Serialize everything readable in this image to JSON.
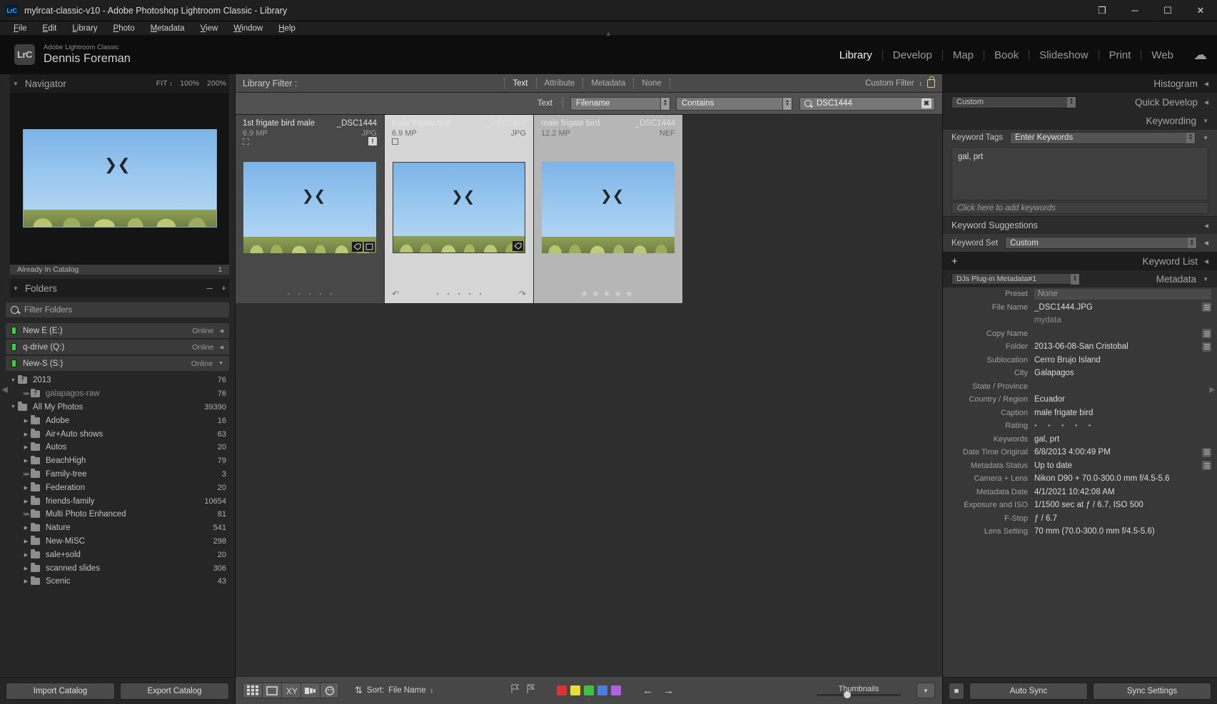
{
  "window": {
    "title": "mylrcat-classic-v10 - Adobe Photoshop Lightroom Classic - Library",
    "logo": "LrC",
    "restore_icon": "❐",
    "minimize_icon": "─",
    "maximize_icon": "☐",
    "close_icon": "✕"
  },
  "menubar": {
    "items": [
      "File",
      "Edit",
      "Library",
      "Photo",
      "Metadata",
      "View",
      "Window",
      "Help"
    ]
  },
  "identity": {
    "badge": "LrC",
    "app_name": "Adobe Lightroom Classic",
    "user_name": "Dennis Foreman",
    "cloud_icon": "cloud-icon"
  },
  "modules": {
    "items": [
      "Library",
      "Develop",
      "Map",
      "Book",
      "Slideshow",
      "Print",
      "Web"
    ],
    "active": "Library"
  },
  "navigator": {
    "title": "Navigator",
    "zoom_fit": "FIT",
    "zoom_100": "100%",
    "zoom_200": "200%",
    "already_in_catalog": "Already In Catalog",
    "already_count": "1"
  },
  "folders_panel": {
    "title": "Folders",
    "minus": "─",
    "plus": "+",
    "filter_placeholder": "Filter Folders",
    "drives": [
      {
        "name": "New E (E:)",
        "status": "Online",
        "caret": "◀"
      },
      {
        "name": "q-drive (Q:)",
        "status": "Online",
        "caret": "◀"
      },
      {
        "name": "New-S (S:)",
        "status": "Online",
        "caret": "▼"
      }
    ],
    "folders": [
      {
        "label": "2013",
        "count": "76",
        "indent": 0,
        "disc": "▼",
        "q": true
      },
      {
        "label": "galapagos-raw",
        "count": "76",
        "indent": 1,
        "disc": "⋙",
        "q": true,
        "dim": true
      },
      {
        "label": "All My Photos",
        "count": "39390",
        "indent": 0,
        "disc": "▼",
        "q": false
      },
      {
        "label": "Adobe",
        "count": "16",
        "indent": 1,
        "disc": "▶",
        "q": false
      },
      {
        "label": "Air+Auto shows",
        "count": "63",
        "indent": 1,
        "disc": "▶",
        "q": false
      },
      {
        "label": "Autos",
        "count": "20",
        "indent": 1,
        "disc": "▶",
        "q": false
      },
      {
        "label": "BeachHigh",
        "count": "79",
        "indent": 1,
        "disc": "▶",
        "q": false
      },
      {
        "label": "Family-tree",
        "count": "3",
        "indent": 1,
        "disc": "⋙",
        "q": false
      },
      {
        "label": "Federation",
        "count": "20",
        "indent": 1,
        "disc": "▶",
        "q": false
      },
      {
        "label": "friends-family",
        "count": "10654",
        "indent": 1,
        "disc": "▶",
        "q": false
      },
      {
        "label": "Multi Photo Enhanced",
        "count": "81",
        "indent": 1,
        "disc": "⋙",
        "q": false
      },
      {
        "label": "Nature",
        "count": "541",
        "indent": 1,
        "disc": "▶",
        "q": false
      },
      {
        "label": "New-MiSC",
        "count": "298",
        "indent": 1,
        "disc": "▶",
        "q": false
      },
      {
        "label": "sale+sold",
        "count": "20",
        "indent": 1,
        "disc": "▶",
        "q": false
      },
      {
        "label": "scanned slides",
        "count": "306",
        "indent": 1,
        "disc": "▶",
        "q": false
      },
      {
        "label": "Scenic",
        "count": "43",
        "indent": 1,
        "disc": "▶",
        "q": false
      }
    ],
    "import_catalog": "Import Catalog",
    "export_catalog": "Export Catalog"
  },
  "library_filter": {
    "label": "Library Filter :",
    "tabs": [
      "Text",
      "Attribute",
      "Metadata",
      "None"
    ],
    "active_tab": "Text",
    "custom_filter": "Custom Filter",
    "lock_icon": "lock-icon"
  },
  "text_filter": {
    "label": "Text",
    "field_select": "Filename",
    "op_select": "Contains",
    "search_value": "DSC1444",
    "clear_icon": "clear-icon"
  },
  "grid": {
    "cells": [
      {
        "title": "1st frigate bird male",
        "filename": "_DSC1444",
        "megapixels": "6.9 MP",
        "filetype": "JPG",
        "selected": false,
        "badge": "!",
        "dots": 5,
        "stars": ""
      },
      {
        "title": "male frigate bird",
        "filename": "_DSC1444",
        "megapixels": "6.9 MP",
        "filetype": "JPG",
        "selected": true,
        "badge": "",
        "dots": 5,
        "stars": ""
      },
      {
        "title": "male frigate bird",
        "filename": "_DSC1444",
        "megapixels": "12.2 MP",
        "filetype": "NEF",
        "selected": false,
        "badge": "",
        "dots": 0,
        "stars": "★★★★★"
      }
    ]
  },
  "toolbar": {
    "grid_view_icon": "grid-view-icon",
    "loupe_view_icon": "loupe-view-icon",
    "compare_view_icon": "compare-view-icon",
    "survey_view_icon": "survey-view-icon",
    "people_view_icon": "people-view-icon",
    "sort_order_icon": "sort-az-icon",
    "sort_label": "Sort:",
    "sort_value": "File Name",
    "flag_icon": "flag-icon",
    "reject_icon": "reject-flag-icon",
    "color_swatches": [
      "#e03030",
      "#e8e030",
      "#40c040",
      "#4a7fe0",
      "#b060e0"
    ],
    "prev_icon": "arrow-left-icon",
    "next_icon": "arrow-right-icon",
    "thumbnails_label": "Thumbnails",
    "caret_icon": "chevron-down-icon"
  },
  "right_panel": {
    "histogram": {
      "title": "Histogram",
      "arrow": "◀"
    },
    "quick_develop": {
      "title": "Quick Develop",
      "preset": "Custom",
      "arrow": "◀"
    },
    "keywording": {
      "title": "Keywording",
      "arrow": "▼",
      "tags_label": "Keyword Tags",
      "tags_mode": "Enter Keywords",
      "tags_value": "gal, prt",
      "add_placeholder": "Click here to add keywords",
      "suggestions_title": "Keyword Suggestions",
      "suggestions_arrow": "◀",
      "set_label": "Keyword Set",
      "set_value": "Custom",
      "set_arrow": "◀"
    },
    "keyword_list": {
      "title": "Keyword List",
      "plus": "+",
      "arrow": "◀"
    },
    "metadata": {
      "title": "Metadata",
      "arrow": "▼",
      "preset_select": "DJs Plug-in Metadata#1",
      "rows": [
        {
          "label": "Preset",
          "value": "None",
          "type": "preset"
        },
        {
          "label": "File Name",
          "value": "_DSC1444.JPG",
          "side": true
        },
        {
          "label": "",
          "value": "mydata",
          "gray": true
        },
        {
          "label": "Copy Name",
          "value": "",
          "side": true
        },
        {
          "label": "Folder",
          "value": "2013-06-08-San Cristobal",
          "side": true
        },
        {
          "label": "Sublocation",
          "value": "Cerro Brujo Island"
        },
        {
          "label": "City",
          "value": "Galapagos"
        },
        {
          "label": "State / Province",
          "value": ""
        },
        {
          "label": "Country / Region",
          "value": "Ecuador"
        },
        {
          "label": "Caption",
          "value": "male frigate bird"
        },
        {
          "label": "Rating",
          "value": "• • • • •",
          "stars": true
        },
        {
          "label": "Keywords",
          "value": "gal, prt"
        },
        {
          "label": "Date Time Original",
          "value": "6/8/2013 4:00:49 PM",
          "side": true
        },
        {
          "label": "Metadata Status",
          "value": "Up to date",
          "side": true
        },
        {
          "label": "Camera + Lens",
          "value": "Nikon D90 + 70.0-300.0 mm f/4.5-5.6"
        },
        {
          "label": "Metadata Date",
          "value": "4/1/2021 10:42:08 AM"
        },
        {
          "label": "Exposure and ISO",
          "value": "1/1500 sec at ƒ / 6.7, ISO 500"
        },
        {
          "label": "F-Stop",
          "value": "ƒ / 6.7"
        },
        {
          "label": "Lens Setting",
          "value": "70 mm (70.0-300.0 mm f/4.5-5.6)"
        }
      ]
    },
    "bottom": {
      "switch_icon": "panel-switch-icon",
      "auto_sync": "Auto Sync",
      "sync_settings": "Sync Settings"
    }
  }
}
